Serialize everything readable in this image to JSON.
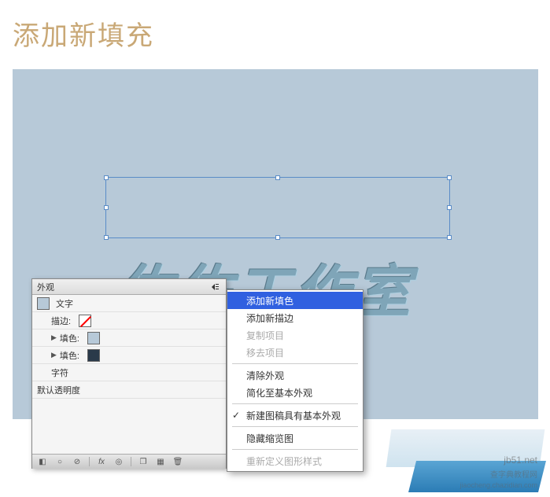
{
  "page": {
    "title": "添加新填充"
  },
  "canvas": {
    "selected_text": "佐佐工作室"
  },
  "appearance_panel": {
    "tab_label": "外观",
    "object_type": "文字",
    "rows": {
      "stroke_label": "描边:",
      "fill1_label": "填色:",
      "fill2_label": "填色:",
      "char_label": "字符",
      "opacity_label": "默认透明度"
    }
  },
  "flyout": {
    "items": {
      "add_fill": "添加新填色",
      "add_stroke": "添加新描边",
      "duplicate": "复制项目",
      "remove": "移去项目",
      "clear": "清除外观",
      "reduce": "简化至基本外观",
      "new_art": "新建图稿具有基本外观",
      "hide_thumb": "隐藏缩览图",
      "redefine": "重新定义图形样式"
    }
  },
  "watermarks": {
    "w1": "jb51.net",
    "w2": "查字典教程网",
    "w3": "jiaocheng.chazidian.com"
  }
}
